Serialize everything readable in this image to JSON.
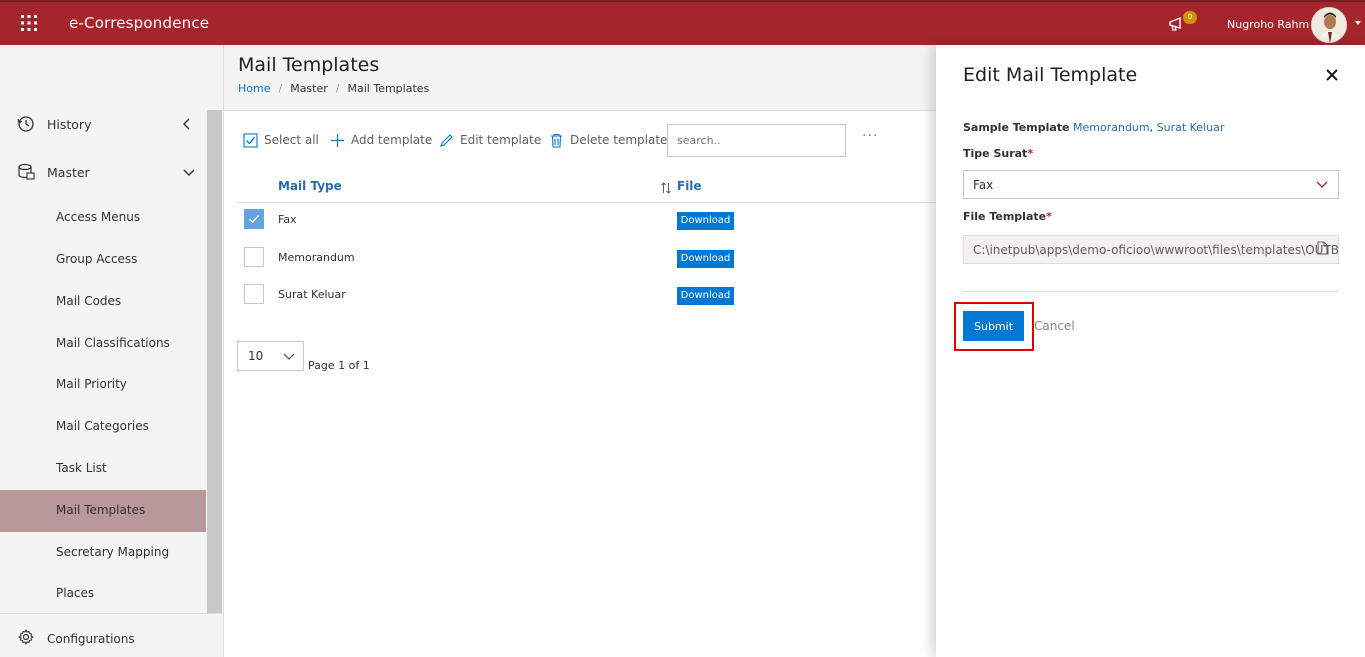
{
  "app": {
    "title": "e-Correspondence",
    "notification_count": "0",
    "user_name": "Nugroho Rahm"
  },
  "sidebar": {
    "history_label": "History",
    "master_label": "Master",
    "sub_items": [
      {
        "label": "Access Menus",
        "active": false
      },
      {
        "label": "Group Access",
        "active": false
      },
      {
        "label": "Mail Codes",
        "active": false
      },
      {
        "label": "Mail Classifications",
        "active": false
      },
      {
        "label": "Mail Priority",
        "active": false
      },
      {
        "label": "Mail Categories",
        "active": false
      },
      {
        "label": "Task List",
        "active": false
      },
      {
        "label": "Mail Templates",
        "active": true
      },
      {
        "label": "Secretary Mapping",
        "active": false
      },
      {
        "label": "Places",
        "active": false
      }
    ],
    "configurations_label": "Configurations"
  },
  "page": {
    "title": "Mail Templates",
    "breadcrumb": {
      "home": "Home",
      "master": "Master",
      "current": "Mail Templates"
    }
  },
  "toolbar": {
    "select_all": "Select all",
    "add": "Add template",
    "edit": "Edit template",
    "delete": "Delete template",
    "search_placeholder": "search..",
    "more": "···"
  },
  "table": {
    "headers": {
      "mail_type": "Mail Type",
      "file": "File"
    },
    "rows": [
      {
        "mail_type": "Fax",
        "file_button": "Download",
        "checked": true
      },
      {
        "mail_type": "Memorandum",
        "file_button": "Download",
        "checked": false
      },
      {
        "mail_type": "Surat Keluar",
        "file_button": "Download",
        "checked": false
      }
    ]
  },
  "pager": {
    "page_size": "10",
    "page_text": "Page 1 of 1"
  },
  "panel": {
    "title": "Edit Mail Template",
    "sample_label": "Sample Template",
    "sample_link_1": "Memorandum",
    "sample_sep": ",",
    "sample_link_2": "Surat Keluar",
    "tipe_surat_label": "Tipe Surat",
    "tipe_surat_value": "Fax",
    "file_template_label": "File Template",
    "file_template_value": "C:\\inetpub\\apps\\demo-oficioo\\wwwroot\\files\\templates\\OUTB",
    "required_mark": "*",
    "submit": "Submit",
    "cancel": "Cancel"
  },
  "colors": {
    "brand": "#a4262c",
    "accent": "#0078d4",
    "active_nav": "#b9989b",
    "highlight": "#e00000"
  }
}
